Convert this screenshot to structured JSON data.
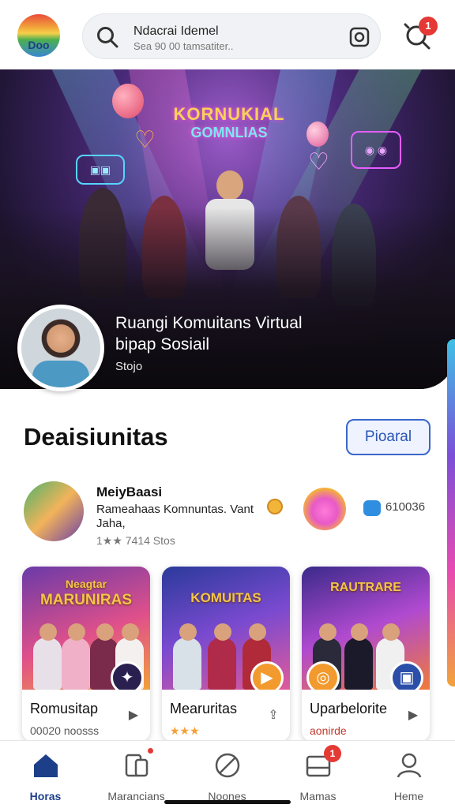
{
  "app": {
    "logo_text": "Doo"
  },
  "search": {
    "title": "Ndacrai Idemel",
    "subtitle": "Sea 90 00 tamsatiter.."
  },
  "notifications": {
    "count": "1"
  },
  "hero": {
    "sign_line1": "KORNUKIAL",
    "sign_line2": "GOMNLIAS",
    "title": "Ruangi Komuitans Virtual",
    "subtitle": "bipap Sosiail",
    "meta": "Stojo"
  },
  "section": {
    "title": "Deaisiunitas",
    "button_label": "Pioaral"
  },
  "featured": {
    "name": "MeiyBaasi",
    "desc_line1": "Rameahaas Komnuntas. Vant",
    "desc_line2": "Jaha,",
    "meta": "1★★ 7414 Stos",
    "count": "610036"
  },
  "cards": [
    {
      "image_title": "MARUNIRAS",
      "image_subtitle": "Neagtar",
      "title": "Romusitap",
      "meta": "00020 noosss",
      "accent": "#2a2050"
    },
    {
      "image_title": "KOMUITAS",
      "image_subtitle": "",
      "title": "Mearuritas",
      "meta": "★★★",
      "accent": "#f29a2e"
    },
    {
      "image_title": "RAUTRARE",
      "image_subtitle": "",
      "title": "Uparbelorite",
      "meta": "aonirde",
      "accent": "#2b4fa8"
    }
  ],
  "nav": {
    "items": [
      {
        "label": "Horas",
        "icon": "home-icon",
        "active": true
      },
      {
        "label": "Marancians",
        "icon": "devices-icon",
        "active": false
      },
      {
        "label": "Noones",
        "icon": "blocked-icon",
        "active": false
      },
      {
        "label": "Mamas",
        "icon": "inbox-icon",
        "active": false
      },
      {
        "label": "Heme",
        "icon": "profile-icon",
        "active": false
      }
    ],
    "badge": "1"
  },
  "colors": {
    "accent": "#1d3f8a",
    "button": "#2a55b5",
    "badge": "#e53935"
  }
}
